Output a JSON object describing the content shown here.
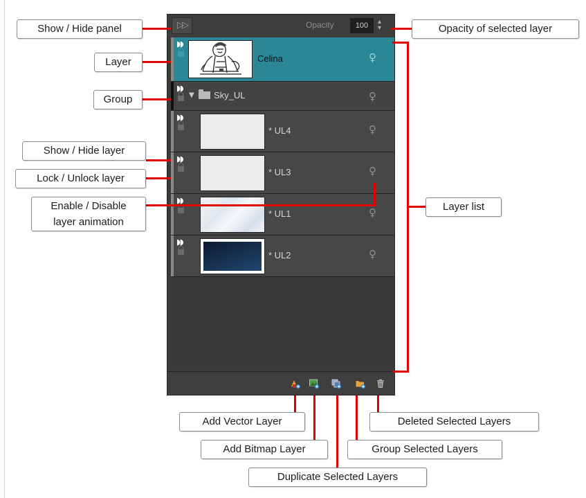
{
  "panel": {
    "opacity_label": "Opacity",
    "opacity_value": "100",
    "showhide_glyph": "▷▷",
    "opacity_spin_glyph": "▲▼",
    "eye_glyph": "◗◗",
    "anim_glyph": "♀"
  },
  "layers": [
    {
      "name": "Celina",
      "type": "drawing",
      "selected": true
    },
    {
      "name": "Sky_UL",
      "type": "group",
      "expanded": true
    },
    {
      "name": "* UL4",
      "type": "drawing"
    },
    {
      "name": "* UL3",
      "type": "drawing"
    },
    {
      "name": "* UL1",
      "type": "drawing"
    },
    {
      "name": "* UL2",
      "type": "drawing"
    }
  ],
  "toolbar": {
    "icons": [
      "add-vector-layer-icon",
      "add-bitmap-layer-icon",
      "duplicate-layers-icon",
      "group-layers-icon",
      "delete-layers-icon"
    ]
  },
  "callouts": {
    "show_hide_panel": "Show / Hide panel",
    "layer": "Layer",
    "group": "Group",
    "show_hide_layer": "Show / Hide layer",
    "lock_unlock_layer": "Lock / Unlock layer",
    "enable_disable_line1": "Enable / Disable",
    "enable_disable_line2": "layer animation",
    "opacity_of_selected": "Opacity of selected layer",
    "layer_list": "Layer list",
    "add_vector": "Add Vector Layer",
    "add_bitmap": "Add Bitmap Layer",
    "duplicate": "Duplicate Selected Layers",
    "deleted": "Deleted Selected Layers",
    "group_selected": "Group Selected Layers"
  },
  "colors": {
    "callout_line": "#e00000",
    "selected_row": "#2a8796",
    "panel_bg": "#3b3b3b"
  }
}
